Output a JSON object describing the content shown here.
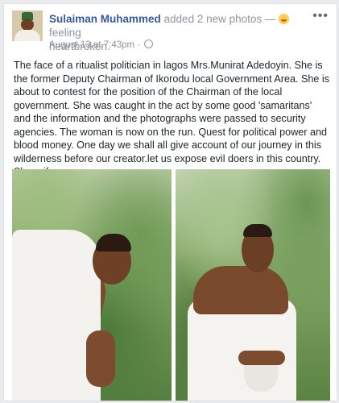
{
  "post": {
    "author_name": "Sulaiman Muhammed",
    "action_text": " added 2 new photos — ",
    "feeling_text": " feeling",
    "feeling_value": "heartbroken.",
    "timestamp": "August 13 at 7:43pm",
    "separator": " · ",
    "more_label": "•••",
    "body_text": "The face of a ritualist politician in lagos Mrs.Munirat Adedoyin. She is the former Deputy Chairman of Ikorodu local Government Area. She is about to contest for the position of the Chairman of the local government. She was caught in the act by some good 'samaritans' and the information and the photographs were passed to security agencies. The woman is now on the run. Quest for political power and blood money. One day we shall all give account of our journey in this wilderness before our creator.let us expose evil doers in this country. Share if you can.",
    "icons": [
      "heartbroken-emoji-icon",
      "globe-icon",
      "more-options-icon"
    ]
  },
  "colors": {
    "author_link": "#365899",
    "meta_text": "#90949c",
    "body_text": "#1d2129"
  }
}
